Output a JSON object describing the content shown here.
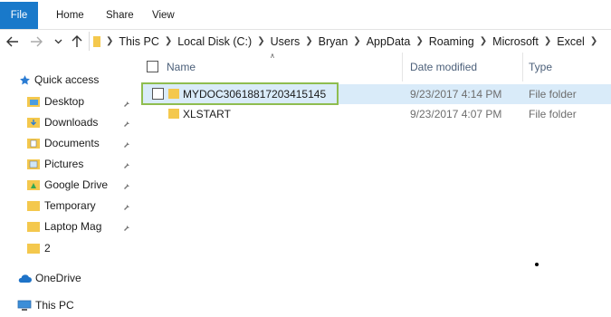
{
  "ribbon": {
    "tabs": [
      "File",
      "Home",
      "Share",
      "View"
    ]
  },
  "address": {
    "crumbs": [
      "This PC",
      "Local Disk (C:)",
      "Users",
      "Bryan",
      "AppData",
      "Roaming",
      "Microsoft",
      "Excel"
    ]
  },
  "nav_pane": {
    "quick_access": "Quick access",
    "items": [
      {
        "label": "Desktop",
        "icon": "desktop-folder-icon",
        "pinned": true
      },
      {
        "label": "Downloads",
        "icon": "downloads-folder-icon",
        "pinned": true
      },
      {
        "label": "Documents",
        "icon": "documents-folder-icon",
        "pinned": true
      },
      {
        "label": "Pictures",
        "icon": "pictures-folder-icon",
        "pinned": true
      },
      {
        "label": "Google Drive",
        "icon": "google-drive-folder-icon",
        "pinned": true
      },
      {
        "label": "Temporary",
        "icon": "folder-icon",
        "pinned": true
      },
      {
        "label": "Laptop Mag",
        "icon": "folder-icon",
        "pinned": true
      },
      {
        "label": "2",
        "icon": "folder-icon",
        "pinned": false
      }
    ],
    "onedrive": "OneDrive",
    "this_pc": "This PC"
  },
  "file_list": {
    "columns": {
      "name": "Name",
      "date": "Date modified",
      "type": "Type"
    },
    "rows": [
      {
        "name": "MYDOC30618817203415145",
        "date": "9/23/2017 4:14 PM",
        "type": "File folder",
        "selected": true
      },
      {
        "name": "XLSTART",
        "date": "9/23/2017 4:07 PM",
        "type": "File folder",
        "selected": false
      }
    ]
  },
  "colors": {
    "file_tab": "#1979ca",
    "folder": "#f4c84d",
    "selection": "#d9ebf9",
    "highlight_border": "#8fbd4f",
    "header_text": "#4c607a"
  }
}
